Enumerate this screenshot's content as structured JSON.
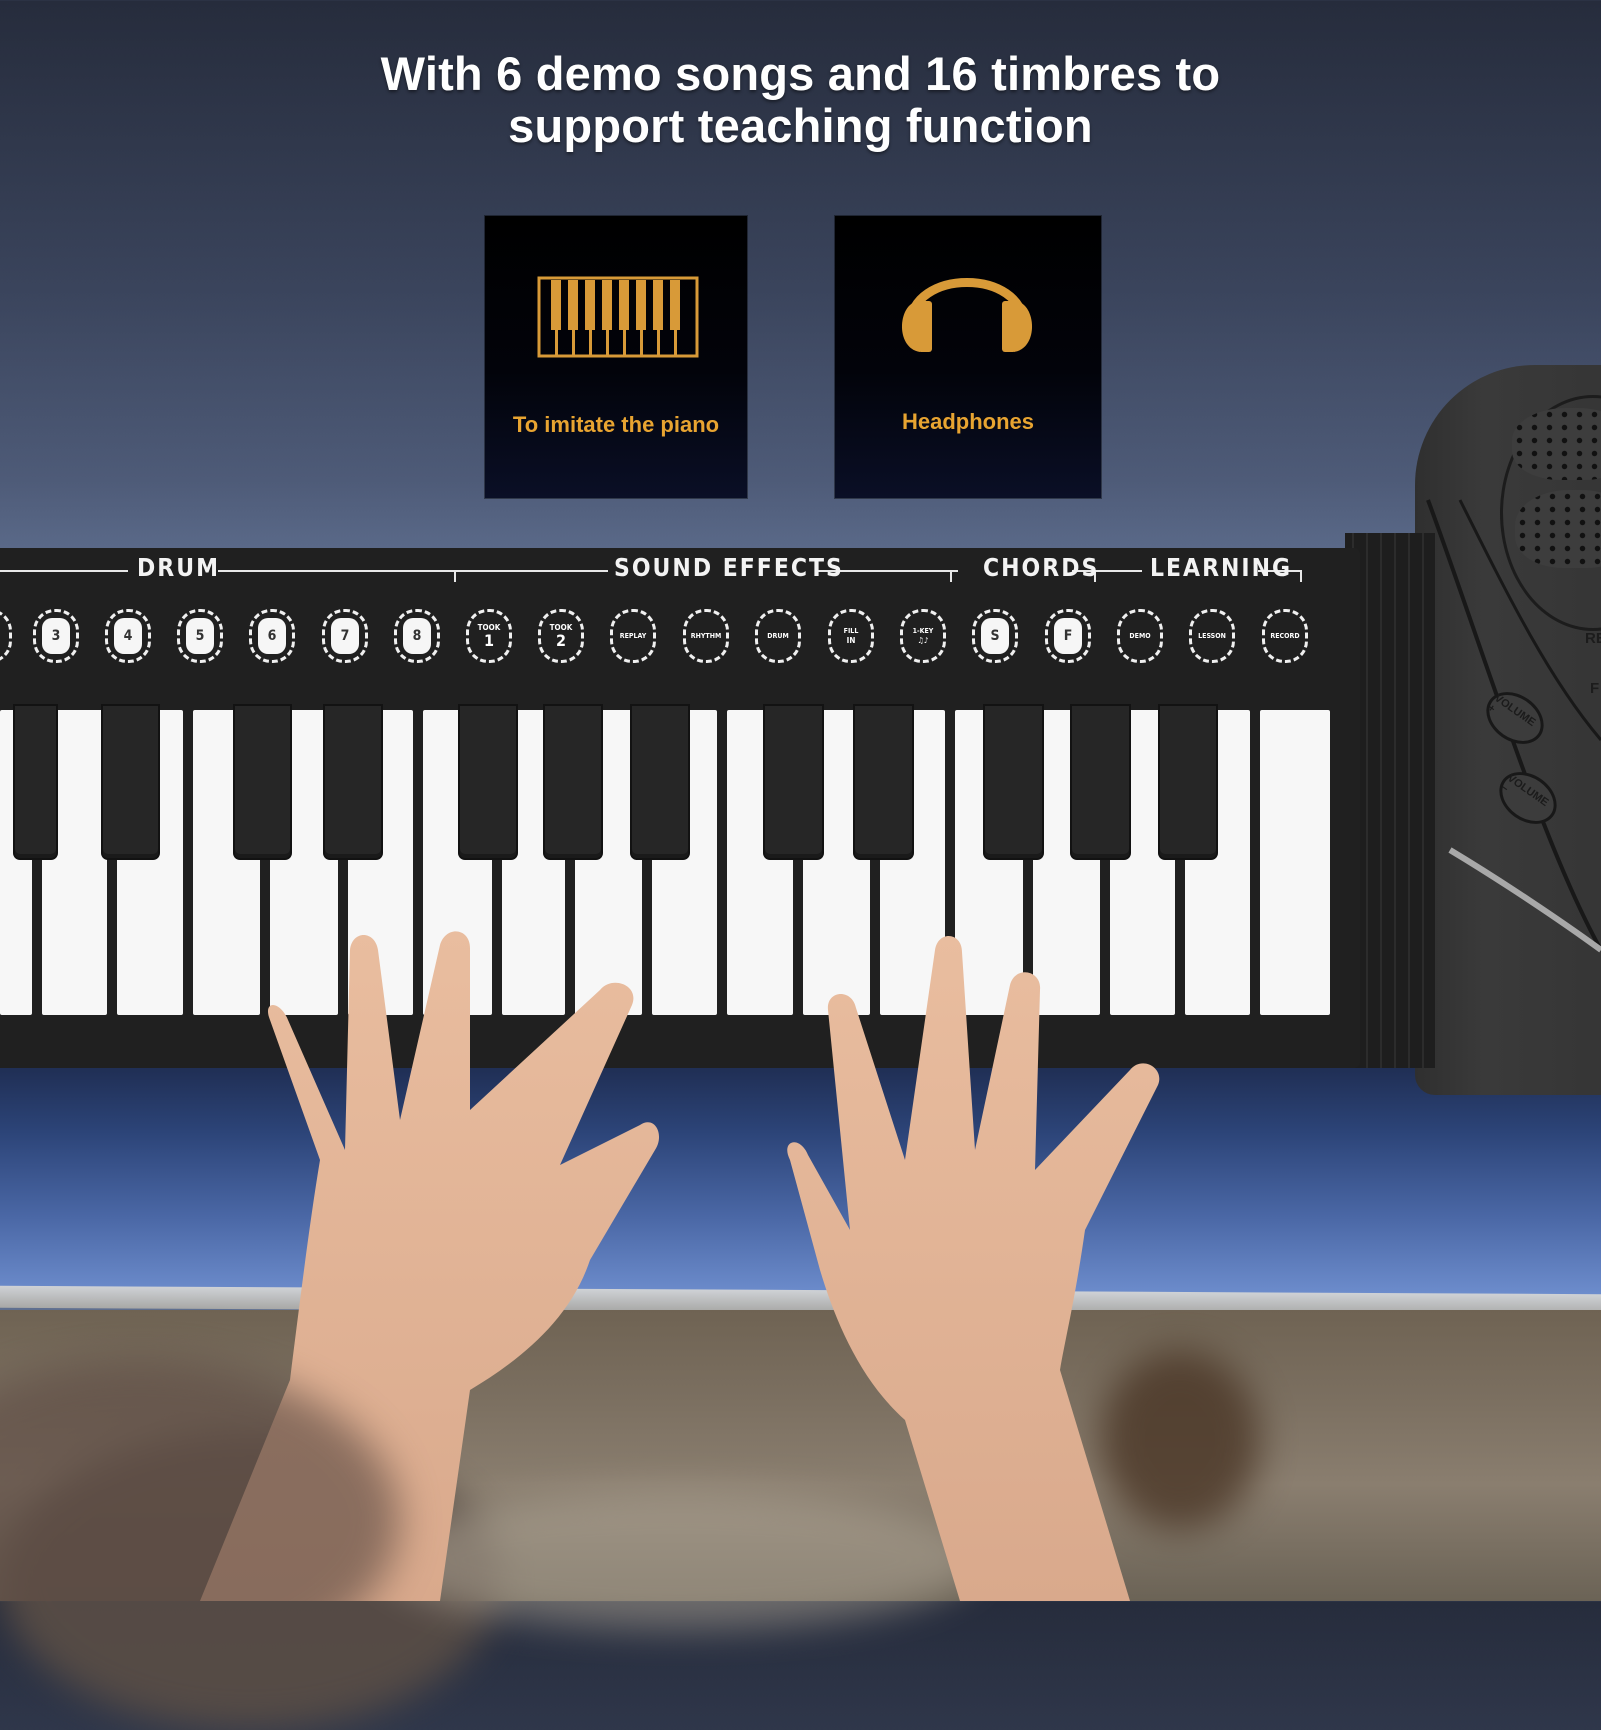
{
  "headline": {
    "line1": "With 6 demo songs and 16 timbres to",
    "line2": "support teaching function"
  },
  "feature_cards": [
    {
      "icon": "piano-keyboard-icon",
      "label": "To imitate the piano"
    },
    {
      "icon": "headphones-icon",
      "label": "Headphones"
    }
  ],
  "accent_color": "#e8a431",
  "panel": {
    "sections": [
      "DRUM",
      "SOUND EFFECTS",
      "CHORDS",
      "LEARNING"
    ],
    "pads": [
      {
        "label": "3",
        "style": "filled"
      },
      {
        "label": "4",
        "style": "filled"
      },
      {
        "label": "5",
        "style": "filled"
      },
      {
        "label": "6",
        "style": "filled"
      },
      {
        "label": "7",
        "style": "filled"
      },
      {
        "label": "8",
        "style": "filled"
      },
      {
        "label": "TOOK",
        "sub": "1",
        "style": "big"
      },
      {
        "label": "TOOK",
        "sub": "2",
        "style": "big"
      },
      {
        "label": "REPLAY",
        "style": "text"
      },
      {
        "label": "RHYTHM",
        "style": "text"
      },
      {
        "label": "DRUM",
        "style": "text"
      },
      {
        "label": "FILL",
        "sub": "IN",
        "style": "text"
      },
      {
        "label": "1-KEY",
        "sub": "♫♪",
        "style": "text"
      },
      {
        "label": "S",
        "style": "filled"
      },
      {
        "label": "F",
        "style": "filled"
      },
      {
        "label": "DEMO",
        "style": "text"
      },
      {
        "label": "LESSON",
        "style": "text"
      },
      {
        "label": "RECORD",
        "style": "text"
      }
    ]
  },
  "speaker_unit": {
    "volume_up_label": "VOLUME +",
    "volume_down_label": "VOLUME −",
    "side_text_1": "RE",
    "side_text_2": "F"
  }
}
